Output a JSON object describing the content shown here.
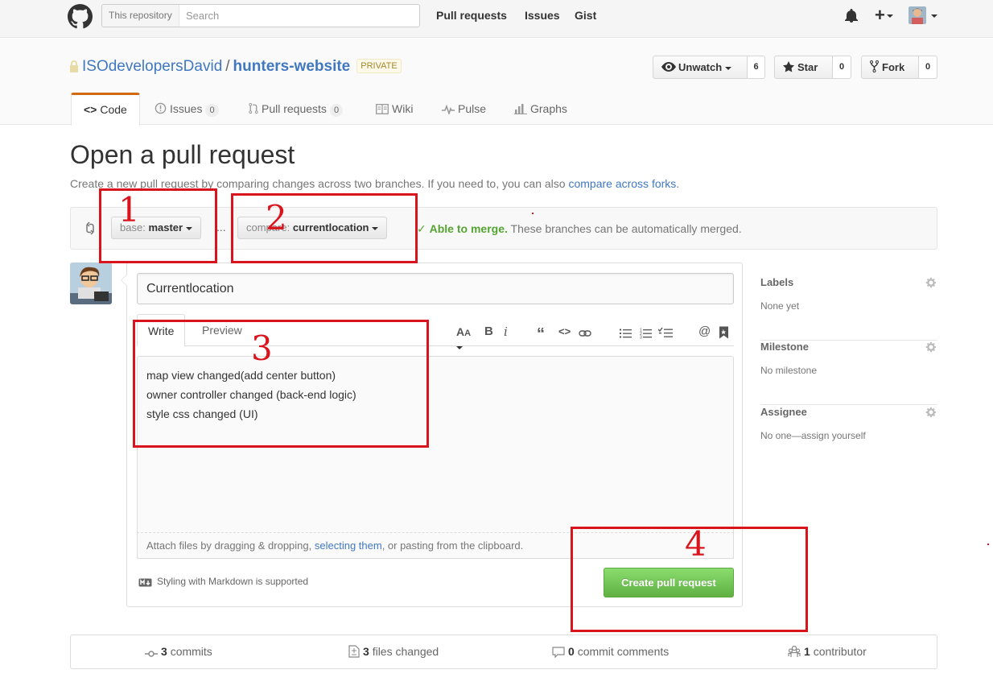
{
  "header": {
    "search_scope": "This repository",
    "search_placeholder": "Search",
    "nav": [
      "Pull requests",
      "Issues",
      "Gist"
    ]
  },
  "repo": {
    "owner": "ISOdevelopersDavid",
    "separator": "/",
    "name": "hunters-website",
    "visibility": "PRIVATE",
    "watch_label": "Unwatch",
    "watch_count": "6",
    "star_label": "Star",
    "star_count": "0",
    "fork_label": "Fork",
    "fork_count": "0",
    "tabs": {
      "code": "Code",
      "issues": "Issues",
      "issues_count": "0",
      "pulls": "Pull requests",
      "pulls_count": "0",
      "wiki": "Wiki",
      "pulse": "Pulse",
      "graphs": "Graphs"
    }
  },
  "page": {
    "title": "Open a pull request",
    "description": "Create a new pull request by comparing changes across two branches. If you need to, you can also ",
    "description_link": "compare across forks",
    "description_end": "."
  },
  "range": {
    "base_label": "base:",
    "base_branch": "master",
    "dots": "...",
    "compare_label": "compare:",
    "compare_branch": "currentlocation",
    "merge_ok": "Able to merge.",
    "merge_text": "These branches can be automatically merged."
  },
  "form": {
    "title_value": "Currentlocation",
    "tab_write": "Write",
    "tab_preview": "Preview",
    "body_lines": [
      "map view changed(add center button)",
      "owner controller changed (back-end logic)",
      "style css changed (UI)"
    ],
    "attach_text_1": "Attach files by dragging & dropping, ",
    "attach_link": "selecting them",
    "attach_text_2": ", or pasting from the clipboard.",
    "markdown_note": "Styling with Markdown is supported",
    "submit_label": "Create pull request"
  },
  "sidebar": {
    "labels_head": "Labels",
    "labels_value": "None yet",
    "milestone_head": "Milestone",
    "milestone_value": "No milestone",
    "assignee_head": "Assignee",
    "assignee_value": "No one—assign yourself"
  },
  "summary": {
    "commits_count": "3",
    "commits_label": "commits",
    "files_count": "3",
    "files_label": "files changed",
    "comments_count": "0",
    "comments_label": "commit comments",
    "contributors_count": "1",
    "contributors_label": "contributor"
  },
  "annotations": [
    "1",
    "2",
    "3",
    "4"
  ],
  "colors": {
    "link": "#4078c0",
    "accent_tab": "#d26911",
    "merge_ok": "#55a532",
    "create_button": "#60b044",
    "annotation_red": "#d9141d"
  }
}
